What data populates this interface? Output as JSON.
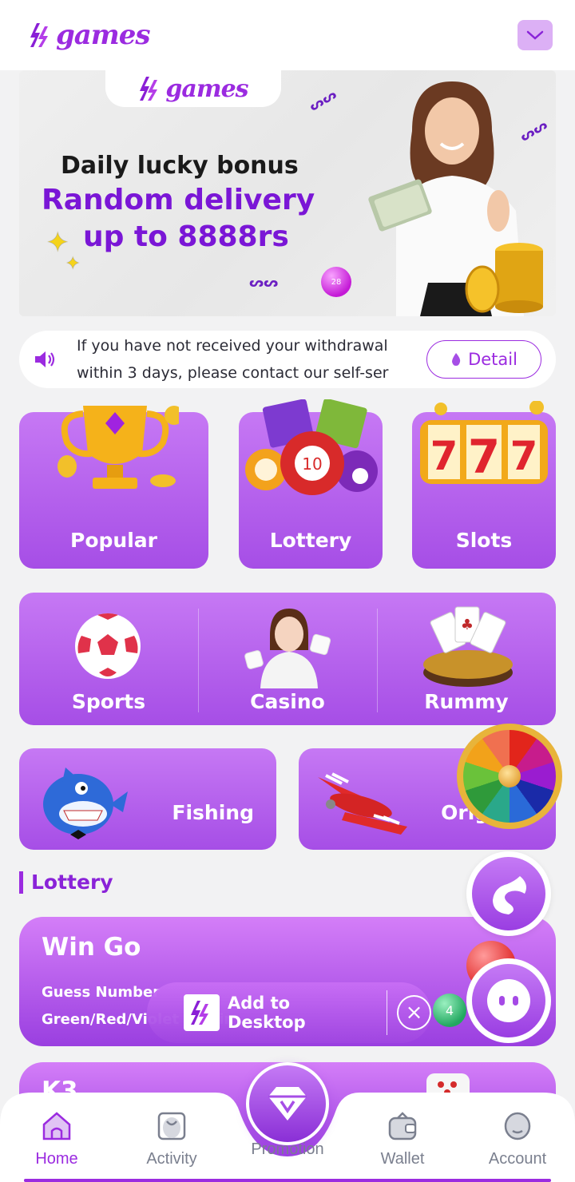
{
  "header": {
    "logo_text": "games",
    "menu_icon": "chevron-down-icon"
  },
  "banner": {
    "logo_text": "games",
    "line1": "Daily lucky bonus",
    "line2": "Random delivery",
    "line3": "up to 8888rs",
    "ball_number": "28"
  },
  "notice": {
    "icon": "speaker-icon",
    "text": "If you have not received your withdrawal within 3 days, please contact our self-ser",
    "detail_label": "Detail"
  },
  "categories": {
    "popular": "Popular",
    "lottery": "Lottery",
    "slots": "Slots",
    "sports": "Sports",
    "casino": "Casino",
    "rummy": "Rummy",
    "fishing": "Fishing",
    "original": "Original"
  },
  "lottery_section": {
    "title": "Lottery",
    "games": [
      {
        "title": "Win Go",
        "sub1": "Guess Number",
        "sub2": "Green/Red/Violet to win"
      },
      {
        "title": "K3"
      }
    ]
  },
  "add_to_desktop": {
    "label": "Add to Desktop",
    "close_icon": "close-icon"
  },
  "tabbar": {
    "items": [
      {
        "label": "Home",
        "active": true
      },
      {
        "label": "Activity",
        "active": false
      },
      {
        "label": "Promotion",
        "active": false
      },
      {
        "label": "Wallet",
        "active": false
      },
      {
        "label": "Account",
        "active": false
      }
    ]
  },
  "colors": {
    "brand": "#9b2be0",
    "card_top": "#c678f4",
    "card_bottom": "#a64ee6",
    "background": "#f2f2f3"
  }
}
